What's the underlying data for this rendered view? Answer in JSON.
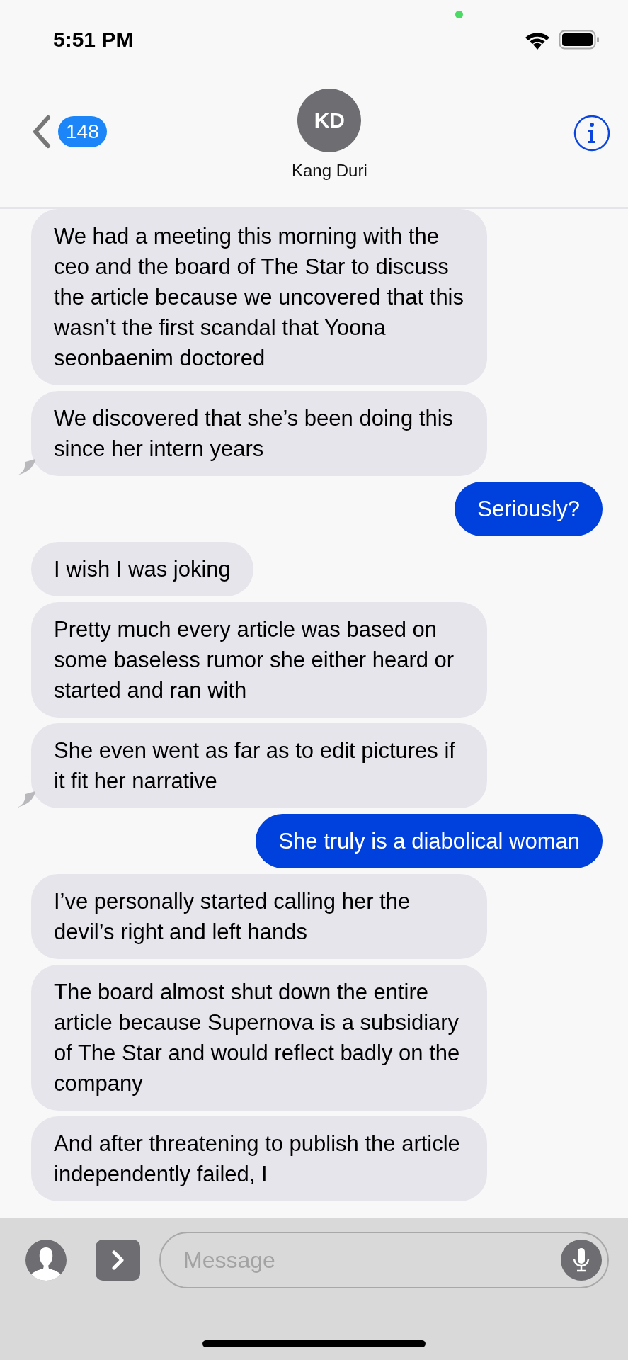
{
  "status_bar": {
    "time": "5:51 PM"
  },
  "header": {
    "back_count": "148",
    "avatar_initials": "KD",
    "contact_name": "Kang Duri"
  },
  "messages": [
    {
      "kind": "received",
      "tail": false,
      "text": "We had a meeting this morning with the ceo and the board of The Star to discuss the article because we uncovered that this wasn’t the first scandal that Yoona seonbaenim doctored"
    },
    {
      "kind": "received",
      "tail": true,
      "text": "We discovered that she’s been doing this since her intern years"
    },
    {
      "kind": "sent",
      "tail": false,
      "text": "Seriously?"
    },
    {
      "kind": "received",
      "tail": false,
      "text": "I wish I was joking"
    },
    {
      "kind": "received",
      "tail": false,
      "text": "Pretty much every article was based on some baseless rumor she either heard or started and ran with"
    },
    {
      "kind": "received",
      "tail": true,
      "text": "She even went as far as to edit pictures if it fit her narrative"
    },
    {
      "kind": "sent",
      "tail": false,
      "text": "She truly is a diabolical woman"
    },
    {
      "kind": "received",
      "tail": false,
      "text": "I’ve personally started calling her the devil’s right and left hands"
    },
    {
      "kind": "received",
      "tail": false,
      "text": "The board almost shut down the entire article because Supernova is a subsidiary of The Star and would reflect badly on the company"
    },
    {
      "kind": "received",
      "tail": false,
      "text": "And after threatening to publish the article independently failed, I"
    }
  ],
  "composer": {
    "placeholder": "Message"
  }
}
